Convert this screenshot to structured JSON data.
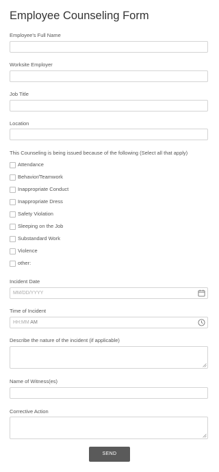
{
  "form": {
    "title": "Employee Counseling Form",
    "fields": {
      "full_name": {
        "label": "Employee's Full Name",
        "value": ""
      },
      "worksite_employer": {
        "label": "Worksite Employer",
        "value": ""
      },
      "job_title": {
        "label": "Job Title",
        "value": ""
      },
      "location": {
        "label": "Location",
        "value": ""
      },
      "reasons": {
        "label": "This Counseling is being issued because of the following (Select all that apply)",
        "options": [
          "Attendance",
          "Behavior/Teamwork",
          "Inappropriate Conduct",
          "Inappropriate Dress",
          "Safety Violation",
          "Sleeping on the Job",
          "Substandard Work",
          "Violence",
          "other:"
        ]
      },
      "incident_date": {
        "label": "Incident Date",
        "placeholder": "MM/DD/YYYY"
      },
      "incident_time": {
        "label": "Time of Incident",
        "placeholder": "HH:MM",
        "ampm": "AM"
      },
      "incident_description": {
        "label": "Describe the nature of the incident (if applicable)",
        "value": ""
      },
      "witnesses": {
        "label": "Name of Witness(es)",
        "value": ""
      },
      "corrective_action": {
        "label": "Corrective Action",
        "value": ""
      }
    },
    "submit_label": "SEND"
  },
  "icons": {
    "date": "calendar-icon",
    "time": "clock-icon",
    "resize": "resize-handle-icon"
  }
}
